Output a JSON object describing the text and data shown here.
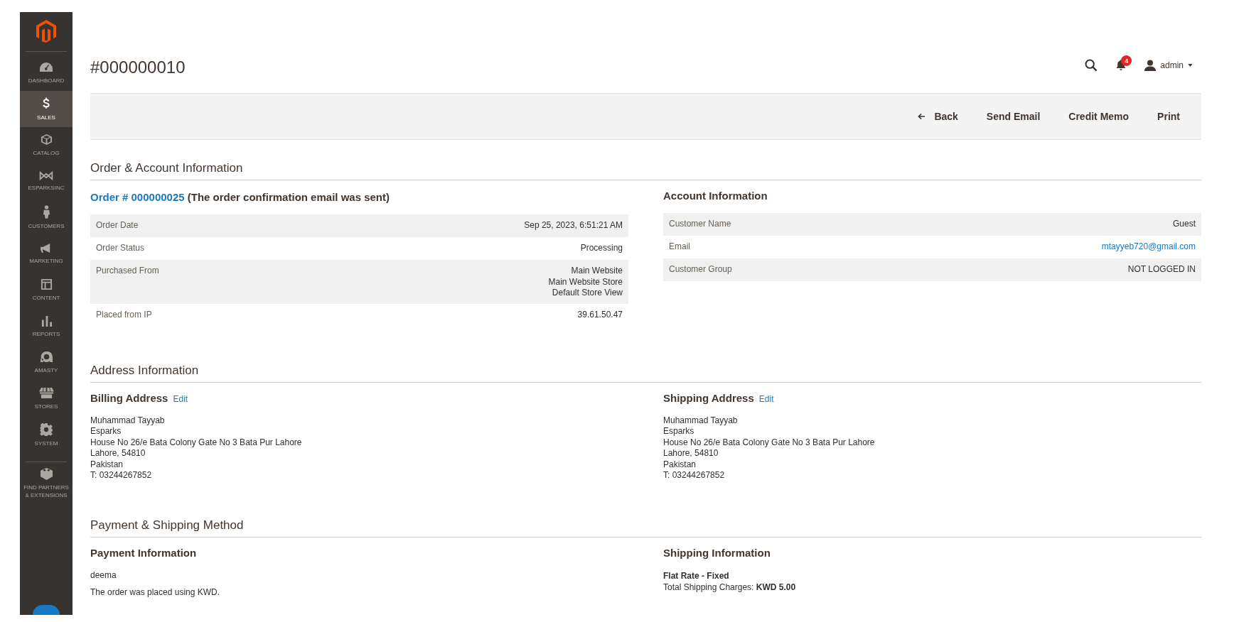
{
  "sidebar": {
    "items": [
      {
        "label": "DASHBOARD",
        "selected": false
      },
      {
        "label": "SALES",
        "selected": true
      },
      {
        "label": "CATALOG",
        "selected": false
      },
      {
        "label": "ESPARKSINC",
        "selected": false
      },
      {
        "label": "CUSTOMERS",
        "selected": false
      },
      {
        "label": "MARKETING",
        "selected": false
      },
      {
        "label": "CONTENT",
        "selected": false
      },
      {
        "label": "REPORTS",
        "selected": false
      },
      {
        "label": "AMASTY",
        "selected": false
      },
      {
        "label": "STORES",
        "selected": false
      },
      {
        "label": "SYSTEM",
        "selected": false
      },
      {
        "label": "FIND PARTNERS & EXTENSIONS",
        "selected": false
      }
    ]
  },
  "header": {
    "title": "#000000010",
    "notification_count": "4",
    "user": "admin"
  },
  "toolbar": {
    "buttons": [
      "Back",
      "Send Email",
      "Credit Memo",
      "Print"
    ]
  },
  "sections": [
    {
      "title": "Order & Account Information",
      "kind": "info",
      "columns": [
        {
          "kind": "order",
          "link": "Order # 000000025",
          "note": "(The order confirmation email was sent)",
          "rows": [
            {
              "label": "Order Date",
              "value": [
                "Sep 25, 2023, 6:51:21 AM"
              ],
              "kind": "text"
            },
            {
              "label": "Order Status",
              "value": [
                "Processing"
              ],
              "kind": "text"
            },
            {
              "label": "Purchased From",
              "value": [
                "Main Website",
                "Main Website Store",
                "Default Store View"
              ],
              "kind": "text"
            },
            {
              "label": "Placed from IP",
              "value": [
                "39.61.50.47"
              ],
              "kind": "text"
            }
          ]
        },
        {
          "kind": "account",
          "title": "Account Information",
          "rows": [
            {
              "label": "Customer Name",
              "value": [
                "Guest"
              ],
              "kind": "text"
            },
            {
              "label": "Email",
              "value": [
                "mtayyeb720@gmail.com"
              ],
              "kind": "link"
            },
            {
              "label": "Customer Group",
              "value": [
                "NOT LOGGED IN"
              ],
              "kind": "text"
            }
          ]
        }
      ]
    },
    {
      "title": "Address Information",
      "kind": "address",
      "columns": [
        {
          "title": "Billing Address",
          "edit": "Edit",
          "lines": [
            "Muhammad Tayyab",
            "Esparks",
            "House No 26/e Bata Colony Gate No 3 Bata Pur Lahore",
            "Lahore, 54810",
            "Pakistan",
            "T: 03244267852"
          ]
        },
        {
          "title": "Shipping Address",
          "edit": "Edit",
          "lines": [
            "Muhammad Tayyab",
            "Esparks",
            "House No 26/e Bata Colony Gate No 3 Bata Pur Lahore",
            "Lahore, 54810",
            "Pakistan",
            "T: 03244267852"
          ]
        }
      ]
    },
    {
      "title": "Payment & Shipping Method",
      "kind": "method",
      "columns": [
        {
          "kind": "payment",
          "title": "Payment Information",
          "lines": [
            "deema",
            "The order was placed using KWD."
          ]
        },
        {
          "kind": "shipping",
          "title": "Shipping Information",
          "method": "Flat Rate - Fixed",
          "lines": [
            "Total Shipping Charges: **KWD 5.00**"
          ]
        }
      ]
    }
  ]
}
